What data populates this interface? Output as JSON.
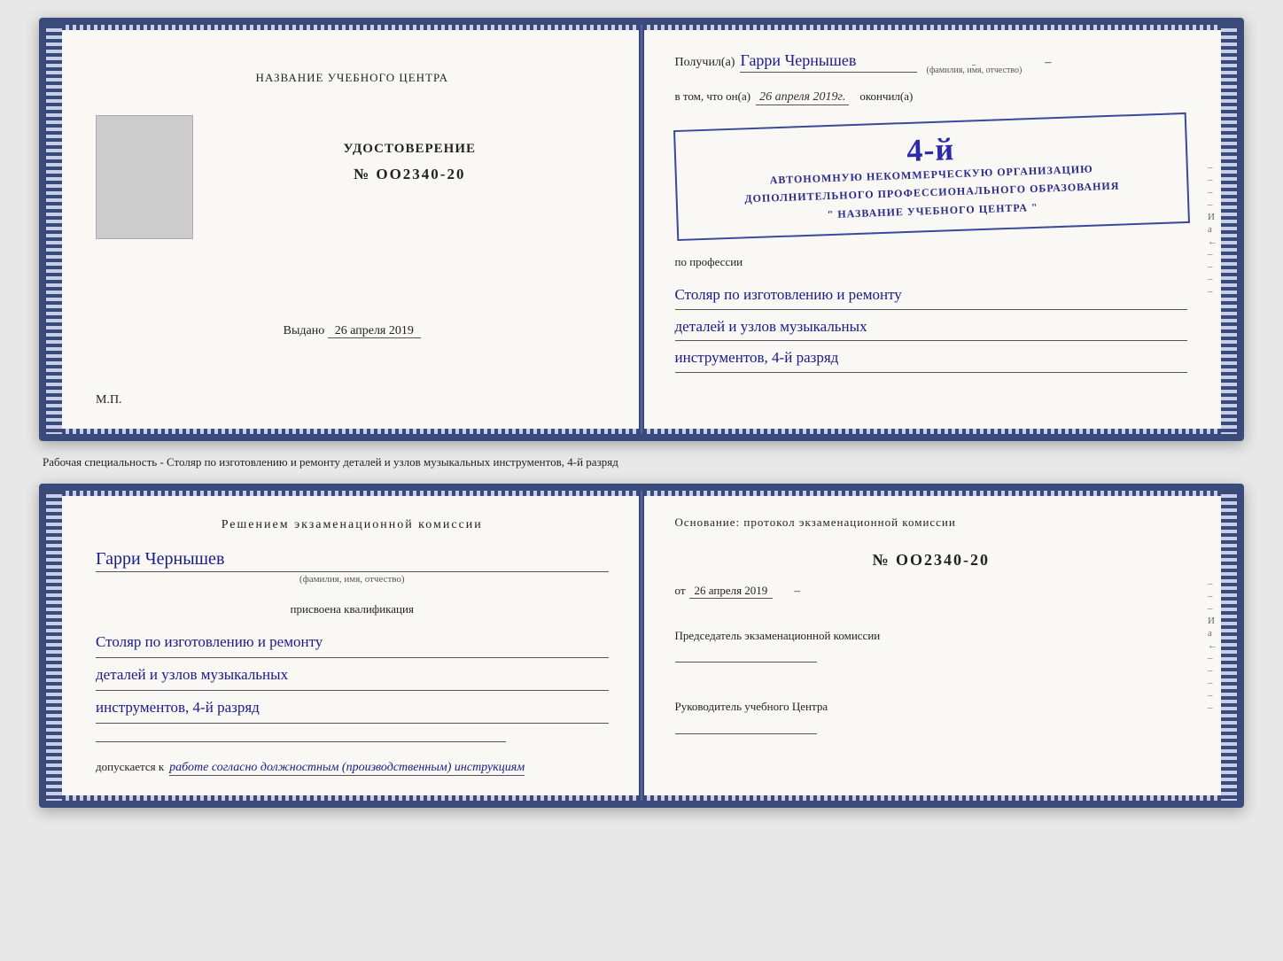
{
  "cert1": {
    "left": {
      "org_label": "НАЗВАНИЕ УЧЕБНОГО ЦЕНТРА",
      "photo_alt": "photo",
      "cert_title": "УДОСТОВЕРЕНИЕ",
      "cert_number": "№ OO2340-20",
      "issued_label": "Выдано",
      "issued_date": "26 апреля 2019",
      "mp_label": "М.П."
    },
    "right": {
      "received_label": "Получил(а)",
      "recipient_name": "Гарри Чернышев",
      "fio_label": "(фамилия, имя, отчество)",
      "vtom_label": "в том, что он(а)",
      "date_handwritten": "26 апреля 2019г.",
      "finished_label": "окончил(а)",
      "stamp_line1": "АВТОНОМНУЮ НЕКОММЕРЧЕСКУЮ ОРГАНИЗАЦИЮ",
      "stamp_line2": "ДОПОЛНИТЕЛЬНОГО ПРОФЕССИОНАЛЬНОГО ОБРАЗОВАНИЯ",
      "stamp_line3": "\" НАЗВАНИЕ УЧЕБНОГО ЦЕНТРА \"",
      "stamp_number": "4-й",
      "profession_label": "по профессии",
      "profession_line1": "Столяр по изготовлению и ремонту",
      "profession_line2": "деталей и узлов музыкальных",
      "profession_line3": "инструментов, 4-й разряд"
    }
  },
  "caption": {
    "text": "Рабочая специальность - Столяр по изготовлению и ремонту деталей и узлов музыкальных инструментов, 4-й разряд"
  },
  "cert2": {
    "left": {
      "commission_heading": "Решением  экзаменационной  комиссии",
      "name": "Гарри Чернышев",
      "fio_label": "(фамилия, имя, отчество)",
      "qualification_label": "присвоена квалификация",
      "qual_line1": "Столяр по изготовлению и ремонту",
      "qual_line2": "деталей и узлов музыкальных",
      "qual_line3": "инструментов, 4-й разряд",
      "allowed_label": "допускается к",
      "allowed_text": "работе согласно должностным (производственным) инструкциям"
    },
    "right": {
      "foundation_label": "Основание: протокол экзаменационной  комиссии",
      "number": "№  OO2340-20",
      "date_prefix": "от",
      "date": "26 апреля 2019",
      "chairman_label": "Председатель экзаменационной комиссии",
      "director_label": "Руководитель учебного Центра"
    }
  },
  "side_letters": {
    "right_top": [
      "–",
      "–",
      "–",
      "–",
      "И",
      "а",
      "←",
      "–",
      "–",
      "–",
      "–"
    ],
    "right_top2": [
      "–",
      "–",
      "–",
      "И",
      "а",
      "←",
      "–",
      "–",
      "–",
      "–",
      "–"
    ]
  }
}
